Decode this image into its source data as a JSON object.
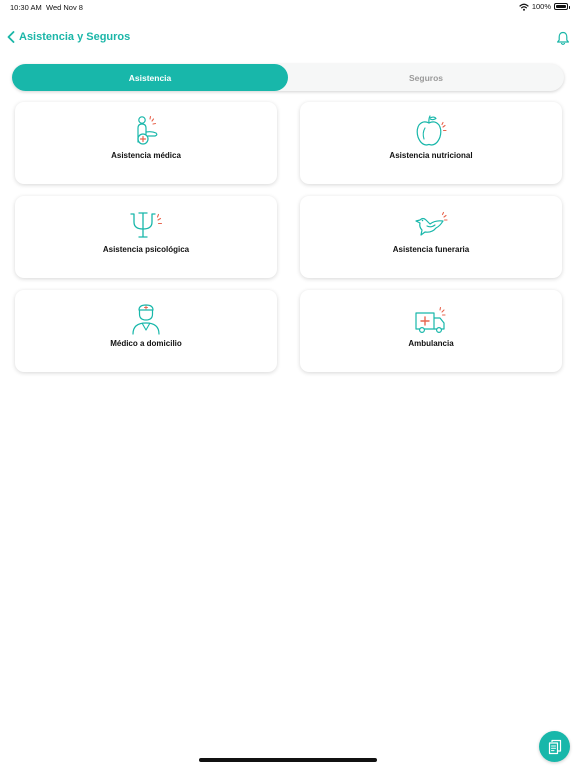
{
  "status_bar": {
    "time": "10:30 AM",
    "date": "Wed Nov 8",
    "battery": "100%",
    "battery_level": 1.0,
    "icons": [
      "wifi-icon",
      "battery-icon"
    ]
  },
  "nav": {
    "title": "Asistencia y Seguros",
    "back_icon": "chevron-left-icon",
    "right_icon": "bell-icon"
  },
  "tabs": [
    {
      "label": "Asistencia",
      "selected": true
    },
    {
      "label": "Seguros",
      "selected": false
    }
  ],
  "cards": [
    {
      "label": "Asistencia médica",
      "icon": "medical-assistance-icon"
    },
    {
      "label": "Asistencia nutricional",
      "icon": "apple-icon"
    },
    {
      "label": "Asistencia psicológica",
      "icon": "psi-icon"
    },
    {
      "label": "Asistencia funeraria",
      "icon": "dove-icon"
    },
    {
      "label": "Médico a domicilio",
      "icon": "doctor-icon"
    },
    {
      "label": "Ambulancia",
      "icon": "ambulance-icon"
    }
  ],
  "fab": {
    "icon": "documents-icon"
  },
  "colors": {
    "accent": "#18b7aa",
    "icon_highlight": "#e8654f",
    "inactive_text": "#9a9a9a"
  }
}
